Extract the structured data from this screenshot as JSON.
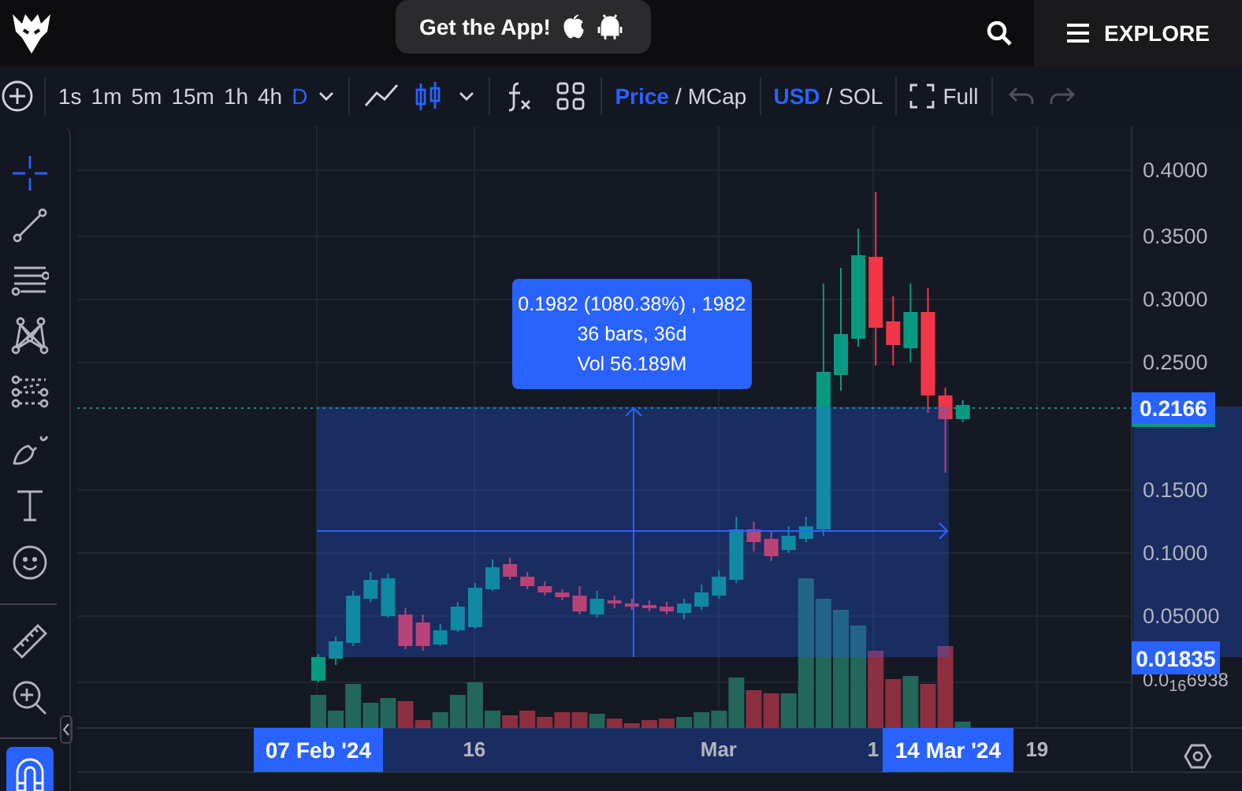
{
  "header": {
    "app_button": "Get the App!",
    "explore": "EXPLORE"
  },
  "toolbar": {
    "intervals": [
      {
        "label": "1s",
        "selected": false
      },
      {
        "label": "1m",
        "selected": false
      },
      {
        "label": "5m",
        "selected": false
      },
      {
        "label": "15m",
        "selected": false
      },
      {
        "label": "1h",
        "selected": false
      },
      {
        "label": "4h",
        "selected": false
      },
      {
        "label": "D",
        "selected": true
      }
    ],
    "chart_types": [
      {
        "kind": "line",
        "selected": false
      },
      {
        "kind": "candles",
        "selected": true
      }
    ],
    "value_modes": [
      {
        "label": "Price",
        "selected": true
      },
      {
        "label": "MCap",
        "selected": false
      }
    ],
    "value_separator": "/",
    "currencies": [
      {
        "label": "USD",
        "selected": true
      },
      {
        "label": "SOL",
        "selected": false
      }
    ],
    "currency_separator": "/",
    "fullscreen": "Full",
    "undo": {
      "disabled": true
    },
    "redo": {
      "disabled": true
    }
  },
  "drawing_tools": [
    {
      "kind": "crosshair",
      "selected": true
    },
    {
      "kind": "trend-line",
      "selected": false
    },
    {
      "kind": "horizontal-lines",
      "selected": false
    },
    {
      "kind": "pattern",
      "selected": false
    },
    {
      "kind": "channel",
      "selected": false
    },
    {
      "kind": "brush",
      "selected": false
    },
    {
      "kind": "text",
      "selected": false
    },
    {
      "kind": "emoji",
      "selected": false
    },
    {
      "kind": "ruler",
      "selected": false
    },
    {
      "kind": "zoom",
      "selected": false
    },
    {
      "kind": "magnet",
      "selected": true
    }
  ],
  "chart": {
    "price_ticks": [
      "0.4000",
      "0.3500",
      "0.3000",
      "0.2500",
      "0.1500",
      "0.1000",
      "0.05000",
      "0.0$_{16}$6938"
    ],
    "time_ticks": [
      "16",
      "Mar",
      "1",
      "19"
    ],
    "current_price": "0.2166",
    "measure": {
      "lines": [
        "0.1982 (1080.38%) , 1982",
        "36 bars, 36d",
        "Vol 56.189M"
      ],
      "start_price": "0.01835",
      "start_date": "07 Feb '24",
      "end_date": "14 Mar '24"
    }
  }
}
